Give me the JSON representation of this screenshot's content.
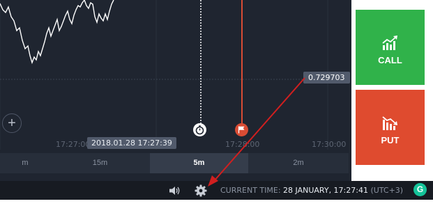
{
  "chart": {
    "price_tag": "0.729703",
    "time_tooltip": "2018.01.28 17:27:39",
    "time_axis": [
      "17:27:00",
      "17:28:00",
      "17:30:00"
    ],
    "zoom_in": "+"
  },
  "periods": [
    {
      "label": "m",
      "active": false
    },
    {
      "label": "15m",
      "active": false
    },
    {
      "label": "5m",
      "active": true
    },
    {
      "label": "2m",
      "active": false
    }
  ],
  "trade": {
    "call_label": "CALL",
    "put_label": "PUT"
  },
  "status": {
    "current_time_label": "CURRENT TIME:",
    "current_time_value": "28 JANUARY, 17:27:41",
    "timezone": "(UTC+3)",
    "grammarly_glyph": "G"
  },
  "icons": {
    "timer": "stopwatch-icon",
    "finish": "flag-icon",
    "sound": "speaker-icon",
    "settings": "gear-icon",
    "call": "trend-up-icon",
    "put": "trend-down-icon"
  },
  "colors": {
    "call": "#30b24a",
    "put": "#df4b2f",
    "finish_line": "#d94c34",
    "annotation_arrow": "#d11f1f"
  }
}
